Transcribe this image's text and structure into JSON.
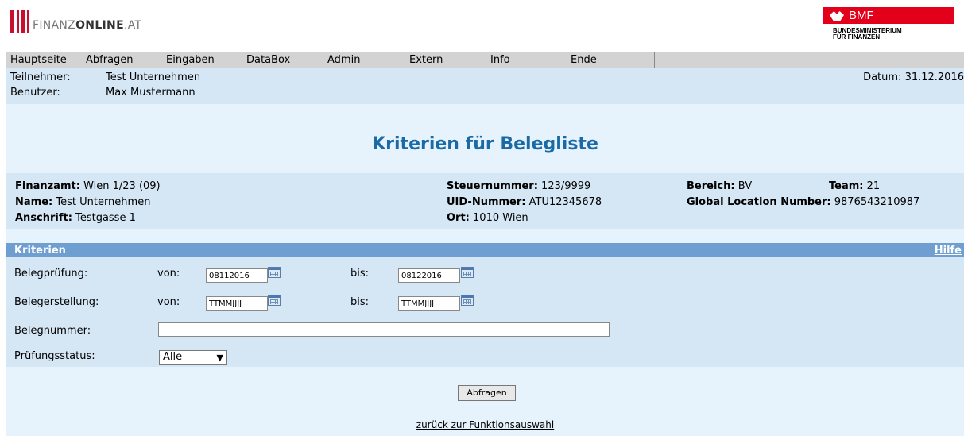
{
  "header": {
    "logo_prefix": "FINANZ",
    "logo_bold": "ONLINE",
    "logo_suffix": ".AT",
    "bmf_label": "BMF",
    "bmf_sub1": "BUNDESMINISTERIUM",
    "bmf_sub2": "FÜR FINANZEN"
  },
  "menu": [
    "Hauptseite",
    "Abfragen",
    "Eingaben",
    "DataBox",
    "Admin",
    "Extern",
    "Info",
    "Ende"
  ],
  "user": {
    "participant_label": "Teilnehmer:",
    "participant": "Test Unternehmen",
    "user_label": "Benutzer:",
    "user": "Max Mustermann",
    "date": "Datum: 31.12.2016"
  },
  "page_title": "Kriterien für Belegliste",
  "taxinfo": {
    "finanzamt_label": "Finanzamt:",
    "finanzamt": "Wien 1/23  (09)",
    "name_label": "Name:",
    "name": "Test Unternehmen",
    "address_label": "Anschrift:",
    "address": "Testgasse 1",
    "steuer_label": "Steuernummer:",
    "steuer": "123/9999",
    "uid_label": "UID-Nummer:",
    "uid": "ATU12345678",
    "ort_label": "Ort:",
    "ort": "1010 Wien",
    "bereich_label": "Bereich:",
    "bereich": "BV",
    "team_label": "Team:",
    "team": "21",
    "gln_label": "Global Location Number:",
    "gln": "9876543210987"
  },
  "criteria": {
    "header": "Kriterien",
    "help": "Hilfe",
    "belegpruefung_label": "Belegprüfung:",
    "belegerstellung_label": "Belegerstellung:",
    "von_label": "von:",
    "bis_label": "bis:",
    "belegpruefung_von": "08112016",
    "belegpruefung_bis": "08122016",
    "belegerstellung_von": "TTMMJJJJ",
    "belegerstellung_bis": "TTMMJJJJ",
    "belegnummer_label": "Belegnummer:",
    "belegnummer_value": "",
    "status_label": "Prüfungsstatus:",
    "status_value": "Alle"
  },
  "actions": {
    "submit": "Abfragen",
    "back": "zurück zur Funktionsauswahl"
  },
  "colors": {
    "title": "#1a6aa5",
    "criteria_header": "#6e9fd0",
    "panel": "#d5e6f5",
    "brand_red": "#e2001a"
  }
}
